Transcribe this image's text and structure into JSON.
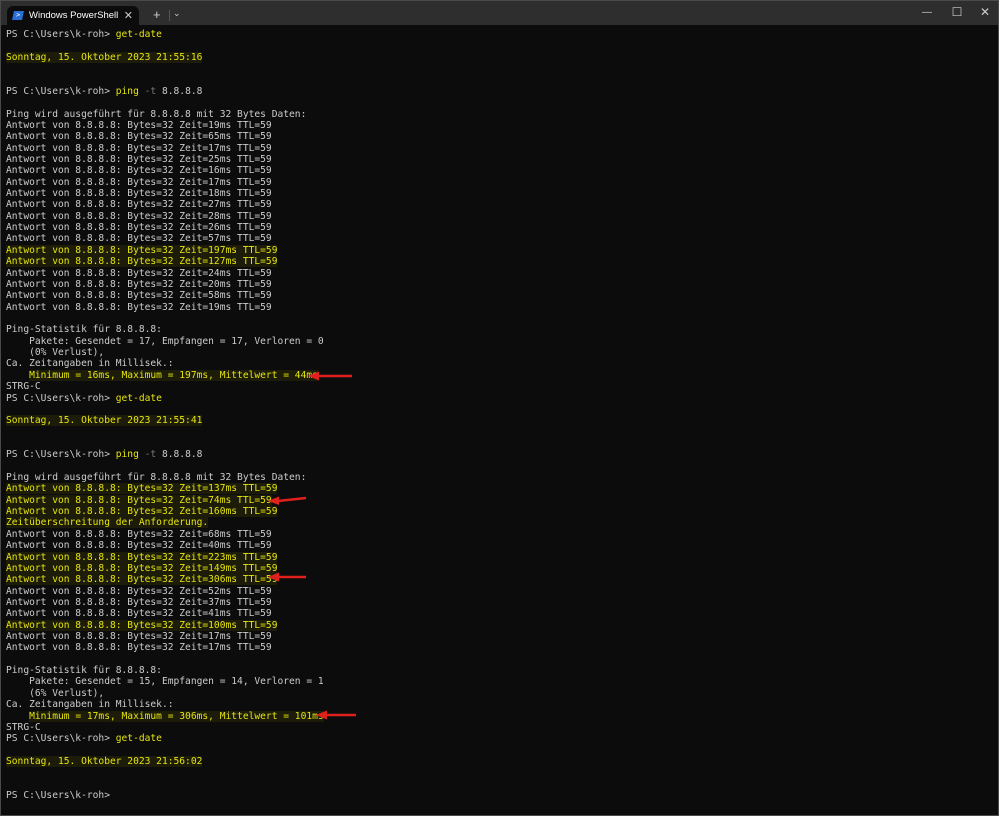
{
  "window": {
    "tab_title": "Windows PowerShell",
    "new_tab": "+",
    "dropdown": "⌄",
    "minimize": "—",
    "maximize": "☐",
    "close": "✕",
    "tab_close": "✕",
    "tab_icon": "powershell-icon"
  },
  "colors": {
    "background": "#0c0c0c",
    "text": "#cccccc",
    "yellow": "#e5e510",
    "arrow": "#e0201c"
  },
  "terminal": {
    "lines": [
      [
        {
          "t": "PS C:\\Users\\k-roh> "
        },
        {
          "t": "get-date",
          "c": "y"
        }
      ],
      [],
      [
        {
          "t": "Sonntag, 15. Oktober 2023 21:55:16",
          "c": "y hl"
        }
      ],
      [],
      [],
      [
        {
          "t": "PS C:\\Users\\k-roh> "
        },
        {
          "t": "ping",
          "c": "y"
        },
        {
          "t": " -t",
          "c": "g"
        },
        {
          "t": " 8.8.8.8"
        }
      ],
      [],
      [
        {
          "t": "Ping wird ausgeführt für 8.8.8.8 mit 32 Bytes Daten:"
        }
      ],
      [
        {
          "t": "Antwort von 8.8.8.8: Bytes=32 Zeit=19ms TTL=59"
        }
      ],
      [
        {
          "t": "Antwort von 8.8.8.8: Bytes=32 Zeit=65ms TTL=59"
        }
      ],
      [
        {
          "t": "Antwort von 8.8.8.8: Bytes=32 Zeit=17ms TTL=59"
        }
      ],
      [
        {
          "t": "Antwort von 8.8.8.8: Bytes=32 Zeit=25ms TTL=59"
        }
      ],
      [
        {
          "t": "Antwort von 8.8.8.8: Bytes=32 Zeit=16ms TTL=59"
        }
      ],
      [
        {
          "t": "Antwort von 8.8.8.8: Bytes=32 Zeit=17ms TTL=59"
        }
      ],
      [
        {
          "t": "Antwort von 8.8.8.8: Bytes=32 Zeit=18ms TTL=59"
        }
      ],
      [
        {
          "t": "Antwort von 8.8.8.8: Bytes=32 Zeit=27ms TTL=59"
        }
      ],
      [
        {
          "t": "Antwort von 8.8.8.8: Bytes=32 Zeit=28ms TTL=59"
        }
      ],
      [
        {
          "t": "Antwort von 8.8.8.8: Bytes=32 Zeit=26ms TTL=59"
        }
      ],
      [
        {
          "t": "Antwort von 8.8.8.8: Bytes=32 Zeit=57ms TTL=59"
        }
      ],
      [
        {
          "t": "Antwort von 8.8.8.8: Bytes=32 Zeit=197ms TTL=59",
          "c": "y hl"
        }
      ],
      [
        {
          "t": "Antwort von 8.8.8.8: Bytes=32 Zeit=127ms TTL=59",
          "c": "y hl"
        }
      ],
      [
        {
          "t": "Antwort von 8.8.8.8: Bytes=32 Zeit=24ms TTL=59"
        }
      ],
      [
        {
          "t": "Antwort von 8.8.8.8: Bytes=32 Zeit=20ms TTL=59"
        }
      ],
      [
        {
          "t": "Antwort von 8.8.8.8: Bytes=32 Zeit=58ms TTL=59"
        }
      ],
      [
        {
          "t": "Antwort von 8.8.8.8: Bytes=32 Zeit=19ms TTL=59"
        }
      ],
      [],
      [
        {
          "t": "Ping-Statistik für 8.8.8.8:"
        }
      ],
      [
        {
          "t": "    Pakete: Gesendet = 17, Empfangen = 17, Verloren = 0"
        }
      ],
      [
        {
          "t": "    (0% Verlust),"
        }
      ],
      [
        {
          "t": "Ca. Zeitangaben in Millisek.:"
        }
      ],
      [
        {
          "t": "    "
        },
        {
          "t": "Minimum = 16ms, Maximum = 197ms, Mittelwert = 44ms",
          "c": "y hl"
        }
      ],
      [
        {
          "t": "STRG-C"
        }
      ],
      [
        {
          "t": "PS C:\\Users\\k-roh> "
        },
        {
          "t": "get-date",
          "c": "y"
        }
      ],
      [],
      [
        {
          "t": "Sonntag, 15. Oktober 2023 21:55:41",
          "c": "y hl"
        }
      ],
      [],
      [],
      [
        {
          "t": "PS C:\\Users\\k-roh> "
        },
        {
          "t": "ping",
          "c": "y"
        },
        {
          "t": " -t",
          "c": "g"
        },
        {
          "t": " 8.8.8.8"
        }
      ],
      [],
      [
        {
          "t": "Ping wird ausgeführt für 8.8.8.8 mit 32 Bytes Daten:"
        }
      ],
      [
        {
          "t": "Antwort von 8.8.8.8: Bytes=32 Zeit=137ms TTL=59",
          "c": "y hl"
        }
      ],
      [
        {
          "t": "Antwort von 8.8.8.8: Bytes=32 Zeit=74ms TTL=59",
          "c": "y hl"
        }
      ],
      [
        {
          "t": "Antwort von 8.8.8.8: Bytes=32 Zeit=160ms TTL=59",
          "c": "y hl"
        }
      ],
      [
        {
          "t": "Zeitüberschreitung der Anforderung.",
          "c": "y hl"
        }
      ],
      [
        {
          "t": "Antwort von 8.8.8.8: Bytes=32 Zeit=68ms TTL=59"
        }
      ],
      [
        {
          "t": "Antwort von 8.8.8.8: Bytes=32 Zeit=40ms TTL=59"
        }
      ],
      [
        {
          "t": "Antwort von 8.8.8.8: Bytes=32 Zeit=223ms TTL=59",
          "c": "y hl"
        }
      ],
      [
        {
          "t": "Antwort von 8.8.8.8: Bytes=32 Zeit=149ms TTL=59",
          "c": "y hl"
        }
      ],
      [
        {
          "t": "Antwort von 8.8.8.8: Bytes=32 Zeit=306ms TTL=59",
          "c": "y hl"
        }
      ],
      [
        {
          "t": "Antwort von 8.8.8.8: Bytes=32 Zeit=52ms TTL=59"
        }
      ],
      [
        {
          "t": "Antwort von 8.8.8.8: Bytes=32 Zeit=37ms TTL=59"
        }
      ],
      [
        {
          "t": "Antwort von 8.8.8.8: Bytes=32 Zeit=41ms TTL=59"
        }
      ],
      [
        {
          "t": "Antwort von 8.8.8.8: Bytes=32 Zeit=100ms TTL=59",
          "c": "y hl"
        }
      ],
      [
        {
          "t": "Antwort von 8.8.8.8: Bytes=32 Zeit=17ms TTL=59"
        }
      ],
      [
        {
          "t": "Antwort von 8.8.8.8: Bytes=32 Zeit=17ms TTL=59"
        }
      ],
      [],
      [
        {
          "t": "Ping-Statistik für 8.8.8.8:"
        }
      ],
      [
        {
          "t": "    Pakete: Gesendet = 15, Empfangen = 14, Verloren = 1"
        }
      ],
      [
        {
          "t": "    (6% Verlust),"
        }
      ],
      [
        {
          "t": "Ca. Zeitangaben in Millisek.:"
        }
      ],
      [
        {
          "t": "    "
        },
        {
          "t": "Minimum = 17ms, Maximum = 306ms, Mittelwert = 101ms",
          "c": "y hl"
        }
      ],
      [
        {
          "t": "STRG-C"
        }
      ],
      [
        {
          "t": "PS C:\\Users\\k-roh> "
        },
        {
          "t": "get-date",
          "c": "y"
        }
      ],
      [],
      [
        {
          "t": "Sonntag, 15. Oktober 2023 21:56:02",
          "c": "y hl"
        }
      ],
      [],
      [],
      [
        {
          "t": "PS C:\\Users\\k-roh> "
        }
      ]
    ]
  }
}
